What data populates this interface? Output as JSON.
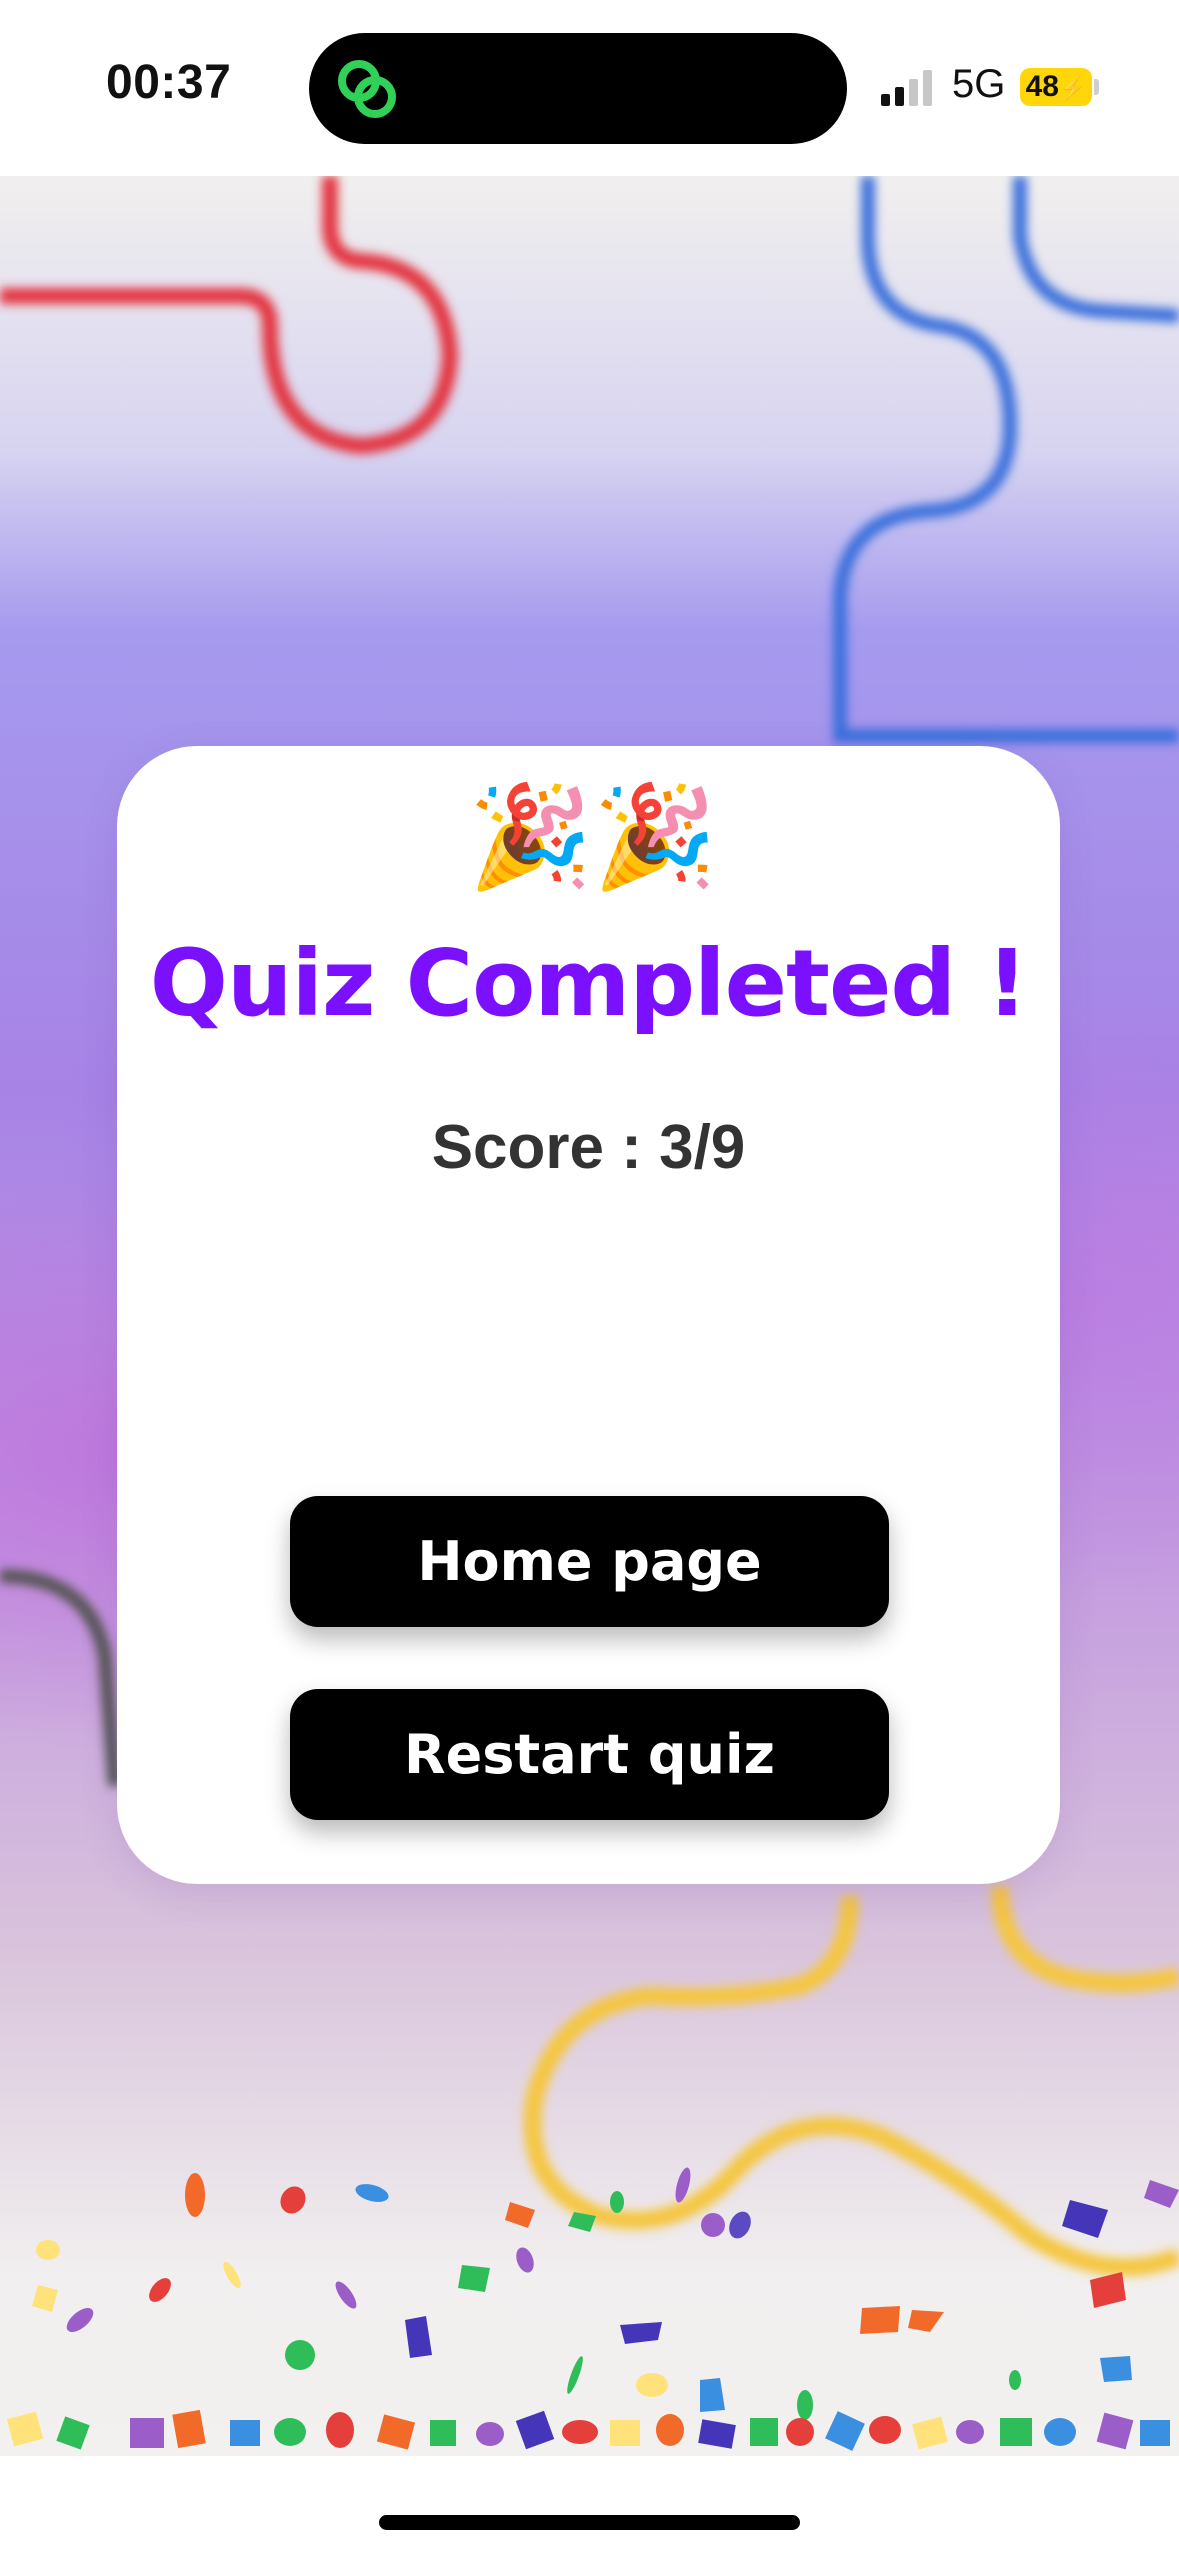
{
  "status_bar": {
    "time": "00:37",
    "network": "5G",
    "battery": "48",
    "island_icon": "green-linked-rings-icon",
    "battery_color": "#ffd60a"
  },
  "result_card": {
    "emoji": "🎉🎉",
    "title": "Quiz Completed !",
    "score_text": "Score : 3/9",
    "score": 3,
    "total": 9,
    "title_color": "#7b10ff"
  },
  "actions": {
    "home_label": "Home page",
    "restart_label": "Restart quiz"
  },
  "colors": {
    "button_bg": "#000000",
    "button_text": "#ffffff",
    "score_text": "#333333"
  }
}
